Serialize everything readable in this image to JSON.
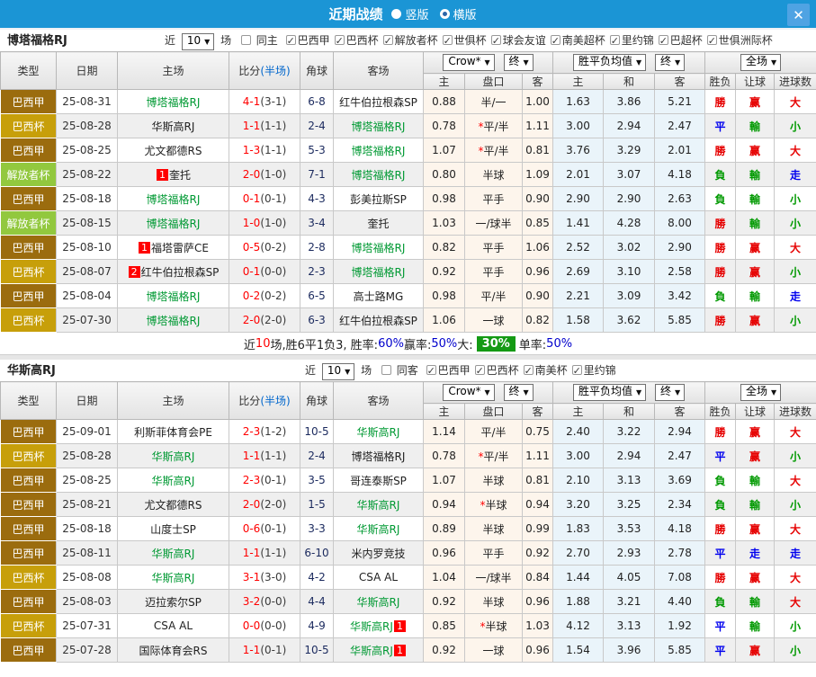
{
  "topbar": {
    "title": "近期战绩",
    "vertical_label": "竖版",
    "horizontal_label": "横版"
  },
  "icons": {
    "close": "✕",
    "caret": "▼",
    "check": "✓"
  },
  "columns": {
    "type": "类型",
    "date": "日期",
    "home": "主场",
    "score": "比分",
    "score_half": "(半场)",
    "corner": "角球",
    "away": "客场",
    "sub": [
      "主",
      "盘口",
      "客",
      "主",
      "和",
      "客",
      "胜负",
      "让球",
      "进球数"
    ]
  },
  "selects": {
    "odds_company": "Crow*",
    "final1": "终",
    "mean": "胜平负均值",
    "final2": "终",
    "scope": "全场"
  },
  "filter_labels": {
    "near": "近",
    "games": "场"
  },
  "type_colors": {
    "巴西甲": "#9b6c0e",
    "巴西杯": "#c79f0a",
    "解放者杯": "#92c83e"
  },
  "result_colors": {
    "r": "#e60000",
    "g": "#009900",
    "b": "#0000ee"
  },
  "sections": [
    {
      "team": "博塔福格RJ",
      "filter": {
        "count": "10",
        "same_label": "同主",
        "same_checked": false,
        "leagues": [
          "巴西甲",
          "巴西杯",
          "解放者杯",
          "世俱杯",
          "球会友谊",
          "南美超杯",
          "里约锦",
          "巴超杯",
          "世俱洲际杯"
        ]
      },
      "rows": [
        {
          "type": "巴西甲",
          "date": "25-08-31",
          "home": "博塔福格RJ",
          "home_green": true,
          "home_badge": "",
          "score": "4-1",
          "half": "(3-1)",
          "corner": "6-8",
          "away": "红牛伯拉根森SP",
          "away_green": false,
          "away_badge": "",
          "odds": [
            "0.88",
            "半/一",
            "1.00"
          ],
          "means": [
            "1.63",
            "3.86",
            "5.21"
          ],
          "results": [
            [
              "勝",
              "r"
            ],
            [
              "赢",
              "r"
            ],
            [
              "大",
              "r"
            ]
          ]
        },
        {
          "type": "巴西杯",
          "date": "25-08-28",
          "home": "华斯高RJ",
          "home_green": false,
          "home_badge": "",
          "score": "1-1",
          "half": "(1-1)",
          "corner": "2-4",
          "away": "博塔福格RJ",
          "away_green": true,
          "away_badge": "",
          "odds": [
            "0.78",
            "*平/半",
            "1.11"
          ],
          "means": [
            "3.00",
            "2.94",
            "2.47"
          ],
          "results": [
            [
              "平",
              "b"
            ],
            [
              "輸",
              "g"
            ],
            [
              "小",
              "g"
            ]
          ]
        },
        {
          "type": "巴西甲",
          "date": "25-08-25",
          "home": "尤文都德RS",
          "home_green": false,
          "home_badge": "",
          "score": "1-3",
          "half": "(1-1)",
          "corner": "5-3",
          "away": "博塔福格RJ",
          "away_green": true,
          "away_badge": "",
          "odds": [
            "1.07",
            "*平/半",
            "0.81"
          ],
          "means": [
            "3.76",
            "3.29",
            "2.01"
          ],
          "results": [
            [
              "勝",
              "r"
            ],
            [
              "赢",
              "r"
            ],
            [
              "大",
              "r"
            ]
          ]
        },
        {
          "type": "解放者杯",
          "date": "25-08-22",
          "home": "奎托",
          "home_green": false,
          "home_badge": "1",
          "score": "2-0",
          "half": "(1-0)",
          "corner": "7-1",
          "away": "博塔福格RJ",
          "away_green": true,
          "away_badge": "",
          "odds": [
            "0.80",
            "半球",
            "1.09"
          ],
          "means": [
            "2.01",
            "3.07",
            "4.18"
          ],
          "results": [
            [
              "負",
              "g"
            ],
            [
              "輸",
              "g"
            ],
            [
              "走",
              "b"
            ]
          ]
        },
        {
          "type": "巴西甲",
          "date": "25-08-18",
          "home": "博塔福格RJ",
          "home_green": true,
          "home_badge": "",
          "score": "0-1",
          "half": "(0-1)",
          "corner": "4-3",
          "away": "彭美拉斯SP",
          "away_green": false,
          "away_badge": "",
          "odds": [
            "0.98",
            "平手",
            "0.90"
          ],
          "means": [
            "2.90",
            "2.90",
            "2.63"
          ],
          "results": [
            [
              "負",
              "g"
            ],
            [
              "輸",
              "g"
            ],
            [
              "小",
              "g"
            ]
          ]
        },
        {
          "type": "解放者杯",
          "date": "25-08-15",
          "home": "博塔福格RJ",
          "home_green": true,
          "home_badge": "",
          "score": "1-0",
          "half": "(1-0)",
          "corner": "3-4",
          "away": "奎托",
          "away_green": false,
          "away_badge": "",
          "odds": [
            "1.03",
            "一/球半",
            "0.85"
          ],
          "means": [
            "1.41",
            "4.28",
            "8.00"
          ],
          "results": [
            [
              "勝",
              "r"
            ],
            [
              "輸",
              "g"
            ],
            [
              "小",
              "g"
            ]
          ]
        },
        {
          "type": "巴西甲",
          "date": "25-08-10",
          "home": "福塔雷萨CE",
          "home_green": false,
          "home_badge": "1",
          "score": "0-5",
          "half": "(0-2)",
          "corner": "2-8",
          "away": "博塔福格RJ",
          "away_green": true,
          "away_badge": "",
          "odds": [
            "0.82",
            "平手",
            "1.06"
          ],
          "means": [
            "2.52",
            "3.02",
            "2.90"
          ],
          "results": [
            [
              "勝",
              "r"
            ],
            [
              "赢",
              "r"
            ],
            [
              "大",
              "r"
            ]
          ]
        },
        {
          "type": "巴西杯",
          "date": "25-08-07",
          "home": "红牛伯拉根森SP",
          "home_green": false,
          "home_badge": "2",
          "score": "0-1",
          "half": "(0-0)",
          "corner": "2-3",
          "away": "博塔福格RJ",
          "away_green": true,
          "away_badge": "",
          "odds": [
            "0.92",
            "平手",
            "0.96"
          ],
          "means": [
            "2.69",
            "3.10",
            "2.58"
          ],
          "results": [
            [
              "勝",
              "r"
            ],
            [
              "赢",
              "r"
            ],
            [
              "小",
              "g"
            ]
          ]
        },
        {
          "type": "巴西甲",
          "date": "25-08-04",
          "home": "博塔福格RJ",
          "home_green": true,
          "home_badge": "",
          "score": "0-2",
          "half": "(0-2)",
          "corner": "6-5",
          "away": "高士路MG",
          "away_green": false,
          "away_badge": "",
          "odds": [
            "0.98",
            "平/半",
            "0.90"
          ],
          "means": [
            "2.21",
            "3.09",
            "3.42"
          ],
          "results": [
            [
              "負",
              "g"
            ],
            [
              "輸",
              "g"
            ],
            [
              "走",
              "b"
            ]
          ]
        },
        {
          "type": "巴西杯",
          "date": "25-07-30",
          "home": "博塔福格RJ",
          "home_green": true,
          "home_badge": "",
          "score": "2-0",
          "half": "(2-0)",
          "corner": "6-3",
          "away": "红牛伯拉根森SP",
          "away_green": false,
          "away_badge": "",
          "odds": [
            "1.06",
            "一球",
            "0.82"
          ],
          "means": [
            "1.58",
            "3.62",
            "5.85"
          ],
          "results": [
            [
              "勝",
              "r"
            ],
            [
              "赢",
              "r"
            ],
            [
              "小",
              "g"
            ]
          ]
        }
      ],
      "summary": [
        [
          "近",
          "k"
        ],
        [
          "10",
          "r"
        ],
        [
          "场,胜6平1负3, 胜率:",
          "k"
        ],
        [
          "60%",
          "b"
        ],
        [
          " 赢率:",
          "k"
        ],
        [
          "50%",
          "b"
        ],
        [
          " 大:",
          "k"
        ],
        [
          "30%",
          "badge"
        ],
        [
          "单率:",
          "k"
        ],
        [
          "50%",
          "b"
        ]
      ]
    },
    {
      "team": "华斯高RJ",
      "filter": {
        "count": "10",
        "same_label": "同客",
        "same_checked": false,
        "leagues": [
          "巴西甲",
          "巴西杯",
          "南美杯",
          "里约锦"
        ]
      },
      "rows": [
        {
          "type": "巴西甲",
          "date": "25-09-01",
          "home": "利斯菲体育会PE",
          "home_green": false,
          "home_badge": "",
          "score": "2-3",
          "half": "(1-2)",
          "corner": "10-5",
          "away": "华斯高RJ",
          "away_green": true,
          "away_badge": "",
          "odds": [
            "1.14",
            "平/半",
            "0.75"
          ],
          "means": [
            "2.40",
            "3.22",
            "2.94"
          ],
          "results": [
            [
              "勝",
              "r"
            ],
            [
              "赢",
              "r"
            ],
            [
              "大",
              "r"
            ]
          ]
        },
        {
          "type": "巴西杯",
          "date": "25-08-28",
          "home": "华斯高RJ",
          "home_green": true,
          "home_badge": "",
          "score": "1-1",
          "half": "(1-1)",
          "corner": "2-4",
          "away": "博塔福格RJ",
          "away_green": false,
          "away_badge": "",
          "odds": [
            "0.78",
            "*平/半",
            "1.11"
          ],
          "means": [
            "3.00",
            "2.94",
            "2.47"
          ],
          "results": [
            [
              "平",
              "b"
            ],
            [
              "赢",
              "r"
            ],
            [
              "小",
              "g"
            ]
          ]
        },
        {
          "type": "巴西甲",
          "date": "25-08-25",
          "home": "华斯高RJ",
          "home_green": true,
          "home_badge": "",
          "score": "2-3",
          "half": "(0-1)",
          "corner": "3-5",
          "away": "哥连泰斯SP",
          "away_green": false,
          "away_badge": "",
          "odds": [
            "1.07",
            "半球",
            "0.81"
          ],
          "means": [
            "2.10",
            "3.13",
            "3.69"
          ],
          "results": [
            [
              "負",
              "g"
            ],
            [
              "輸",
              "g"
            ],
            [
              "大",
              "r"
            ]
          ]
        },
        {
          "type": "巴西甲",
          "date": "25-08-21",
          "home": "尤文都德RS",
          "home_green": false,
          "home_badge": "",
          "score": "2-0",
          "half": "(2-0)",
          "corner": "1-5",
          "away": "华斯高RJ",
          "away_green": true,
          "away_badge": "",
          "odds": [
            "0.94",
            "*半球",
            "0.94"
          ],
          "means": [
            "3.20",
            "3.25",
            "2.34"
          ],
          "results": [
            [
              "負",
              "g"
            ],
            [
              "輸",
              "g"
            ],
            [
              "小",
              "g"
            ]
          ]
        },
        {
          "type": "巴西甲",
          "date": "25-08-18",
          "home": "山度士SP",
          "home_green": false,
          "home_badge": "",
          "score": "0-6",
          "half": "(0-1)",
          "corner": "3-3",
          "away": "华斯高RJ",
          "away_green": true,
          "away_badge": "",
          "odds": [
            "0.89",
            "半球",
            "0.99"
          ],
          "means": [
            "1.83",
            "3.53",
            "4.18"
          ],
          "results": [
            [
              "勝",
              "r"
            ],
            [
              "赢",
              "r"
            ],
            [
              "大",
              "r"
            ]
          ]
        },
        {
          "type": "巴西甲",
          "date": "25-08-11",
          "home": "华斯高RJ",
          "home_green": true,
          "home_badge": "",
          "score": "1-1",
          "half": "(1-1)",
          "corner": "6-10",
          "away": "米内罗竞技",
          "away_green": false,
          "away_badge": "",
          "odds": [
            "0.96",
            "平手",
            "0.92"
          ],
          "means": [
            "2.70",
            "2.93",
            "2.78"
          ],
          "results": [
            [
              "平",
              "b"
            ],
            [
              "走",
              "b"
            ],
            [
              "走",
              "b"
            ]
          ]
        },
        {
          "type": "巴西杯",
          "date": "25-08-08",
          "home": "华斯高RJ",
          "home_green": true,
          "home_badge": "",
          "score": "3-1",
          "half": "(3-0)",
          "corner": "4-2",
          "away": "CSA AL",
          "away_green": false,
          "away_badge": "",
          "odds": [
            "1.04",
            "一/球半",
            "0.84"
          ],
          "means": [
            "1.44",
            "4.05",
            "7.08"
          ],
          "results": [
            [
              "勝",
              "r"
            ],
            [
              "赢",
              "r"
            ],
            [
              "大",
              "r"
            ]
          ]
        },
        {
          "type": "巴西甲",
          "date": "25-08-03",
          "home": "迈拉索尔SP",
          "home_green": false,
          "home_badge": "",
          "score": "3-2",
          "half": "(0-0)",
          "corner": "4-4",
          "away": "华斯高RJ",
          "away_green": true,
          "away_badge": "",
          "odds": [
            "0.92",
            "半球",
            "0.96"
          ],
          "means": [
            "1.88",
            "3.21",
            "4.40"
          ],
          "results": [
            [
              "負",
              "g"
            ],
            [
              "輸",
              "g"
            ],
            [
              "大",
              "r"
            ]
          ]
        },
        {
          "type": "巴西杯",
          "date": "25-07-31",
          "home": "CSA AL",
          "home_green": false,
          "home_badge": "",
          "score": "0-0",
          "half": "(0-0)",
          "corner": "4-9",
          "away": "华斯高RJ",
          "away_green": true,
          "away_badge": "1",
          "odds": [
            "0.85",
            "*半球",
            "1.03"
          ],
          "means": [
            "4.12",
            "3.13",
            "1.92"
          ],
          "results": [
            [
              "平",
              "b"
            ],
            [
              "輸",
              "g"
            ],
            [
              "小",
              "g"
            ]
          ]
        },
        {
          "type": "巴西甲",
          "date": "25-07-28",
          "home": "国际体育会RS",
          "home_green": false,
          "home_badge": "",
          "score": "1-1",
          "half": "(0-1)",
          "corner": "10-5",
          "away": "华斯高RJ",
          "away_green": true,
          "away_badge": "1",
          "odds": [
            "0.92",
            "一球",
            "0.96"
          ],
          "means": [
            "1.54",
            "3.96",
            "5.85"
          ],
          "results": [
            [
              "平",
              "b"
            ],
            [
              "赢",
              "r"
            ],
            [
              "小",
              "g"
            ]
          ]
        }
      ],
      "summary": null
    }
  ]
}
